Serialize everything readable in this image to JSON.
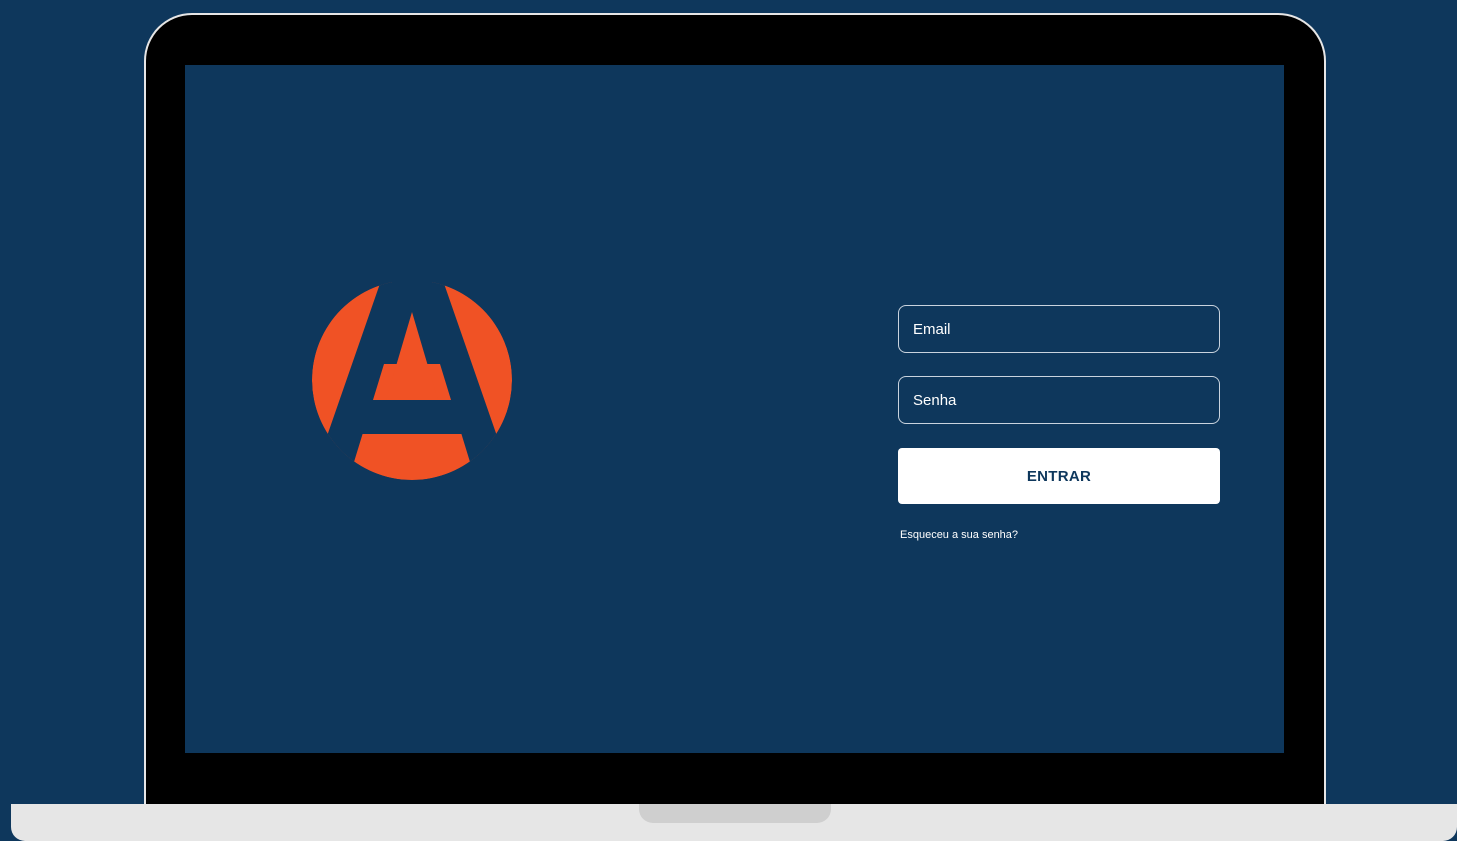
{
  "login": {
    "email_placeholder": "Email",
    "password_placeholder": "Senha",
    "submit_label": "ENTRAR",
    "forgot_password_label": "Esqueceu a sua senha?"
  },
  "logo": {
    "icon": "letter-a-circle-logo"
  },
  "colors": {
    "background": "#0e375c",
    "accent": "#f05225",
    "button_background": "#ffffff",
    "button_text": "#0e375c",
    "laptop_bezel": "#000000",
    "laptop_body": "#e6e6e6"
  }
}
